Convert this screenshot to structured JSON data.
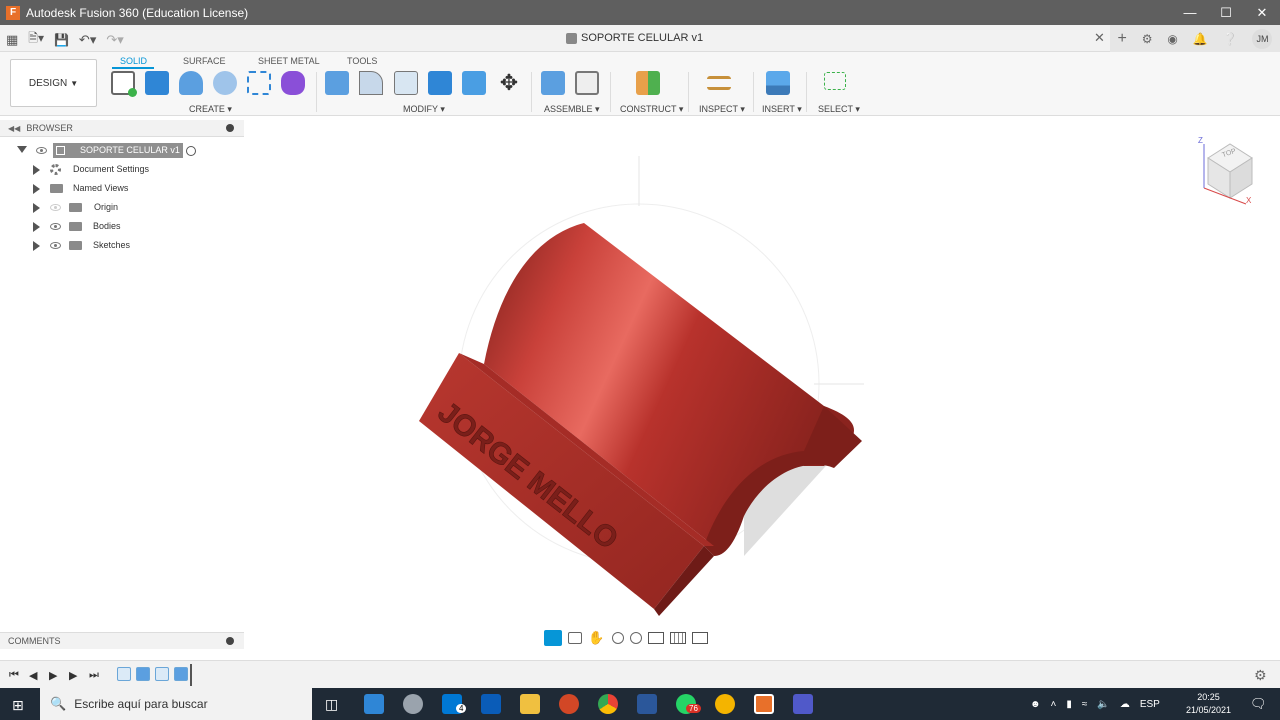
{
  "window": {
    "title": "Autodesk Fusion 360 (Education License)",
    "app_initial": "F"
  },
  "document": {
    "title": "SOPORTE CELULAR v1",
    "user_initials": "JM"
  },
  "toolbar": {
    "workspace_label": "DESIGN",
    "tabs": [
      "SOLID",
      "SURFACE",
      "SHEET METAL",
      "TOOLS"
    ],
    "groups": [
      "CREATE",
      "MODIFY",
      "ASSEMBLE",
      "CONSTRUCT",
      "INSPECT",
      "INSERT",
      "SELECT"
    ]
  },
  "browser": {
    "header": "BROWSER",
    "root": "SOPORTE CELULAR v1",
    "items": [
      "Document Settings",
      "Named Views",
      "Origin",
      "Bodies",
      "Sketches"
    ]
  },
  "comments": {
    "header": "COMMENTS"
  },
  "model": {
    "engraving": "JORGE MELLO",
    "color": "#b8322c"
  },
  "viewcube": {
    "face_label": "TOP",
    "axis_z": "Z",
    "axis_x": "X"
  },
  "taskbar": {
    "search_placeholder": "Escribe aquí para buscar",
    "mail_badge": "4",
    "whatsapp_badge": "76",
    "language": "ESP",
    "time": "20:25",
    "date": "21/05/2021"
  },
  "colors": {
    "accent": "#0696d7",
    "titlebar": "#5f5f5f",
    "taskbar": "#1f2a36"
  }
}
